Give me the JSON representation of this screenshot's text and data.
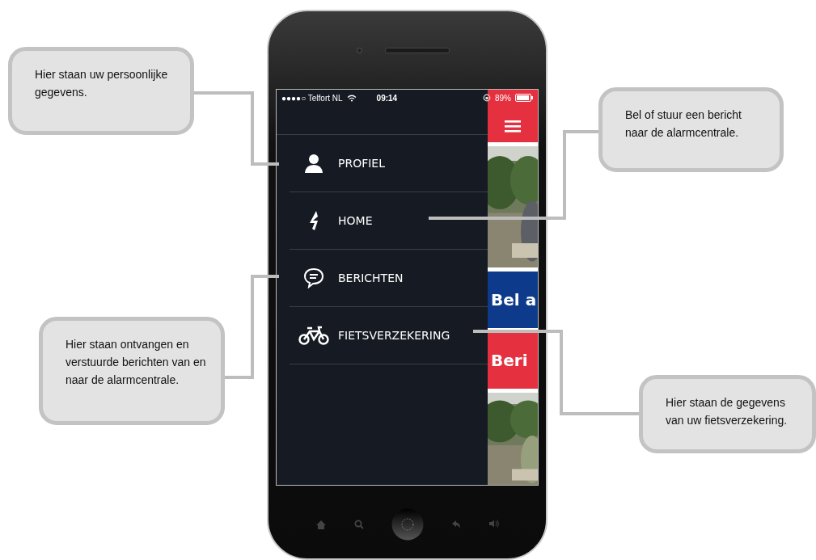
{
  "status_bar": {
    "carrier": "●●●●○ Telfort NL",
    "time": "09:14",
    "battery": "89%"
  },
  "menu": [
    {
      "label": "PROFIEL",
      "kind": "person"
    },
    {
      "label": "HOME",
      "kind": "bolt"
    },
    {
      "label": "BERICHTEN",
      "kind": "chat"
    },
    {
      "label": "FIETSVERZEKERING",
      "kind": "bike"
    }
  ],
  "background_screen": {
    "banners": [
      {
        "text": "Bel a",
        "color": "#0d3a8a"
      },
      {
        "text": "Beri",
        "color": "#e5303f"
      }
    ]
  },
  "callouts": [
    {
      "text": "Hier staan uw persoonlijke gegevens."
    },
    {
      "text": "Bel of stuur een bericht naar de alarmcentrale."
    },
    {
      "text": "Hier staan ontvangen en verstuurde berichten van en naar de alarmcentrale."
    },
    {
      "text": "Hier staan de gegevens van uw fietsverzekering."
    }
  ]
}
